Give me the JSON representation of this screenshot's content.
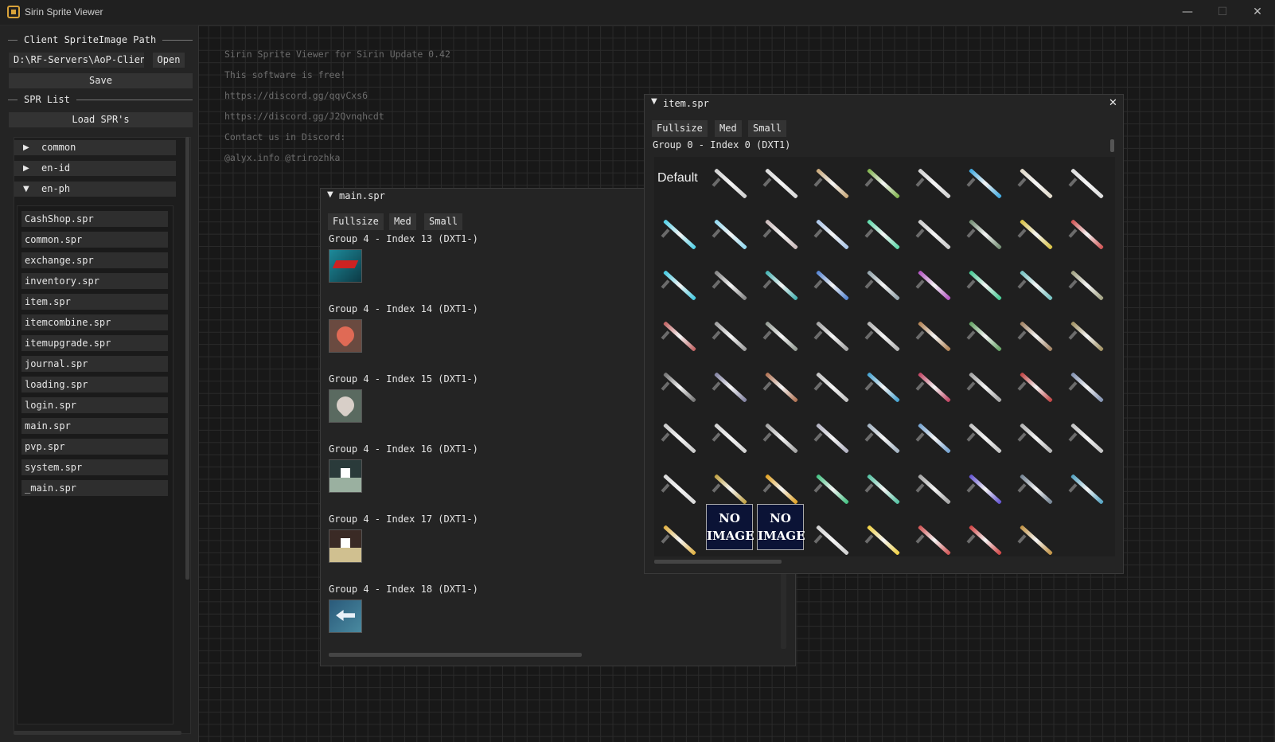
{
  "window": {
    "title": "Sirin Sprite Viewer",
    "minimize_glyph": "—",
    "maximize_glyph": "☐",
    "close_glyph": "✕"
  },
  "sidebar": {
    "path_section_title": "Client SpriteImage Path",
    "path_value": "D:\\RF-Servers\\AoP-Client",
    "open_label": "Open",
    "save_label": "Save",
    "spr_section_title": "SPR List",
    "load_label": "Load SPR's",
    "tree": [
      {
        "label": "common",
        "arrow": "▶"
      },
      {
        "label": "en-id",
        "arrow": "▶"
      },
      {
        "label": "en-ph",
        "arrow": "▼"
      }
    ],
    "files": [
      "CashShop.spr",
      "common.spr",
      "exchange.spr",
      "inventory.spr",
      "item.spr",
      "itemcombine.spr",
      "itemupgrade.spr",
      "journal.spr",
      "loading.spr",
      "login.spr",
      "main.spr",
      "pvp.spr",
      "system.spr",
      "_main.spr"
    ]
  },
  "info": {
    "lines": [
      "Sirin Sprite Viewer for Sirin Update 0.42",
      "This software is free!",
      "https://discord.gg/qqvCxs6",
      "https://discord.gg/J2Qvnqhcdt",
      "Contact us in Discord:",
      "@alyx.info @trirozhka"
    ]
  },
  "main_panel": {
    "title": "main.spr",
    "collapse_glyph": "▼",
    "tabs": [
      "Fullsize",
      "Med",
      "Small"
    ],
    "groups": [
      {
        "label": "Group 4 - Index 13 (DXT1-)",
        "icon": "red-wing-icon"
      },
      {
        "label": "Group 4 - Index 14 (DXT1-)",
        "icon": "heart-handshake-icon"
      },
      {
        "label": "Group 4 - Index 15 (DXT1-)",
        "icon": "heart-handshake-grey-icon"
      },
      {
        "label": "Group 4 - Index 16 (DXT1-)",
        "icon": "box-dark-icon"
      },
      {
        "label": "Group 4 - Index 17 (DXT1-)",
        "icon": "box-brown-icon"
      },
      {
        "label": "Group 4 - Index 18 (DXT1-)",
        "icon": "arrow-swap-icon"
      }
    ]
  },
  "item_panel": {
    "title": "item.spr",
    "collapse_glyph": "▼",
    "close_glyph": "✕",
    "tabs": [
      "Fullsize",
      "Med",
      "Small"
    ],
    "group_label": "Group 0 - Index 0 (DXT1)",
    "sheet_label": "Default",
    "no_image_label_1": "NO",
    "no_image_label_2": "IMAGE",
    "weapon_rows": [
      {
        "kind": "swords",
        "colors": [
          "#cfcfcf",
          "#d8d8d8",
          "#c7a676",
          "#7fb24a",
          "#d0d0d0",
          "#3aa7e0",
          "#e0d8c8",
          "#dcdcdc"
        ]
      },
      {
        "kind": "glaives",
        "colors": [
          "#4fd0e8",
          "#8fd8f0",
          "#c9b8b8",
          "#a8c4e8",
          "#5ad8a8",
          "#c8c8c8",
          "#6f8a6f",
          "#d8c040",
          "#d05050"
        ]
      },
      {
        "kind": "maces",
        "colors": [
          "#40c8e0",
          "#808080",
          "#40b0b0",
          "#5080d0",
          "#8fa0a8",
          "#b050c0",
          "#40c890",
          "#70c0c0",
          "#a0a080"
        ]
      },
      {
        "kind": "spears",
        "colors": [
          "#c06060",
          "#9a9a9a",
          "#909890",
          "#a0a0a0",
          "#b0b0b0",
          "#b08050",
          "#60a060",
          "#a08060",
          "#a09060"
        ]
      },
      {
        "kind": "guns",
        "colors": [
          "#707070",
          "#8080a0",
          "#b07050",
          "#c0c0c0",
          "#40a0d0",
          "#c04060",
          "#a0a0a0",
          "#c04040",
          "#8090b0"
        ]
      },
      {
        "kind": "daggers",
        "colors": [
          "#c8c8c8",
          "#d0d0d0",
          "#a0a0a0",
          "#b0b0c0",
          "#a0b0c0",
          "#70a0d0",
          "#c0c0c0",
          "#b0b0b0",
          "#c0c0c0"
        ]
      },
      {
        "kind": "heavies",
        "colors": [
          "#d8d8d8",
          "#c0a040",
          "#e0a020",
          "#40c080",
          "#50c0a0",
          "#a0a0a0",
          "#6050d0",
          "#708090",
          "#50a0c0"
        ]
      },
      {
        "kind": "mixed",
        "colors": [
          "#e0b040",
          "#d0d0d0",
          "#f0d040",
          "#d05050",
          "#d04040",
          "#c09040"
        ]
      }
    ]
  }
}
